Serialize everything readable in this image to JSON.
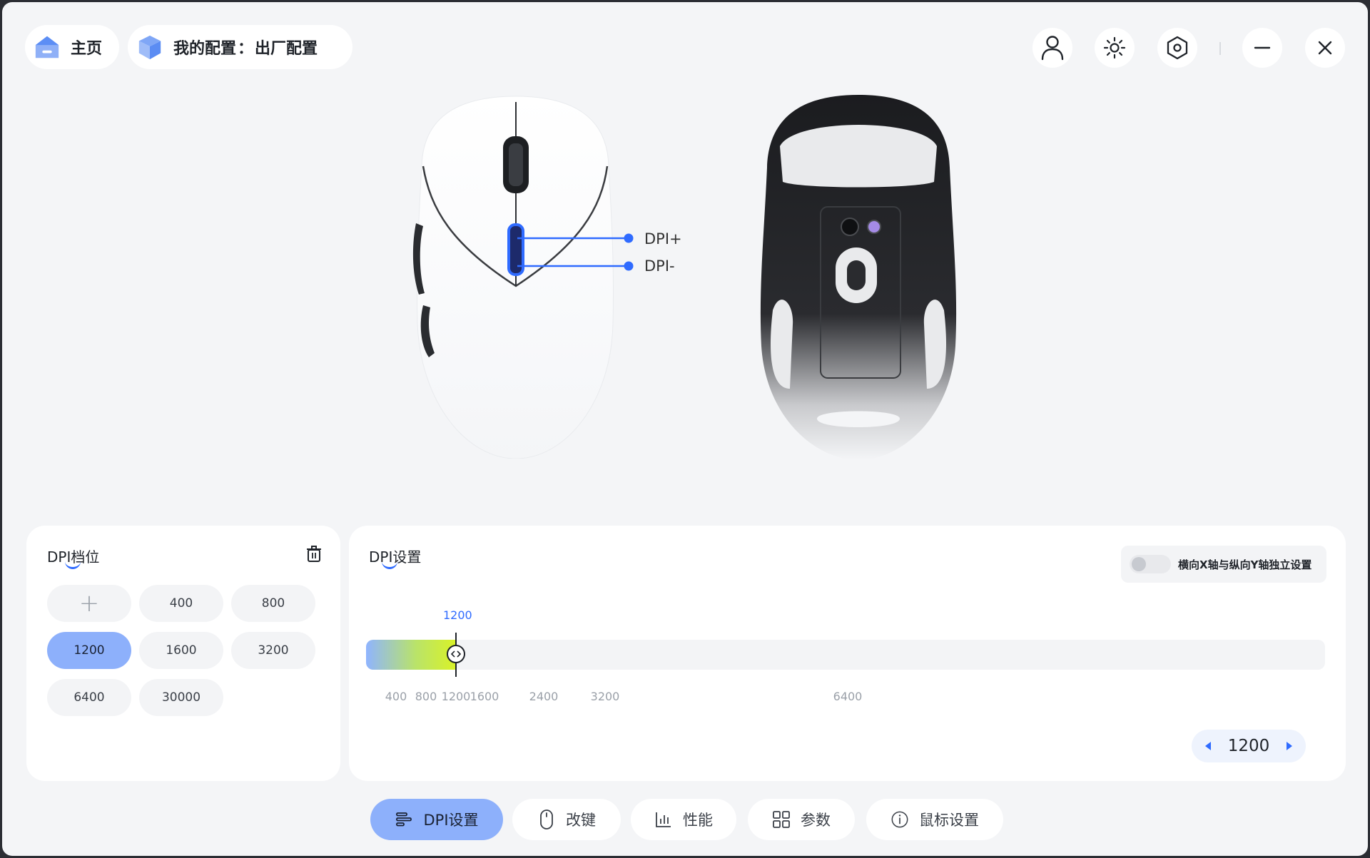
{
  "header": {
    "home_label": "主页",
    "profile_label": "我的配置",
    "profile_separator": "：",
    "profile_name": "出厂配置"
  },
  "icons": {
    "home": "home-icon",
    "profile": "cube-icon",
    "account": "user-icon",
    "lighting": "sun-icon",
    "settings": "hex-gear-icon",
    "minimize": "minimize-icon",
    "close": "close-icon"
  },
  "mouse": {
    "dpi_plus_label": "DPI+",
    "dpi_minus_label": "DPI-"
  },
  "dpi_levels": {
    "title": "DPI档位",
    "add_symbol": "+",
    "values": [
      "400",
      "800",
      "1200",
      "1600",
      "3200",
      "6400",
      "30000"
    ],
    "selected": "1200"
  },
  "dpi_settings": {
    "title": "DPI设置",
    "independent_xy_label": "横向X轴与纵向Y轴独立设置",
    "independent_xy_enabled": false,
    "current_value_label": "1200",
    "current_value": 1200,
    "ticks": [
      "400",
      "800",
      "1200",
      "1600",
      "2400",
      "3200",
      "6400"
    ],
    "stepper_value": "1200"
  },
  "tabs": [
    {
      "label": "DPI设置",
      "icon": "dpi-bars-icon",
      "active": true
    },
    {
      "label": "改键",
      "icon": "mouse-icon",
      "active": false
    },
    {
      "label": "性能",
      "icon": "chart-icon",
      "active": false
    },
    {
      "label": "参数",
      "icon": "grid-icon",
      "active": false
    },
    {
      "label": "鼠标设置",
      "icon": "info-icon",
      "active": false
    }
  ],
  "colors": {
    "accent": "#2f6bff",
    "active_fill": "#8db0fb",
    "background": "#f4f5f7"
  }
}
